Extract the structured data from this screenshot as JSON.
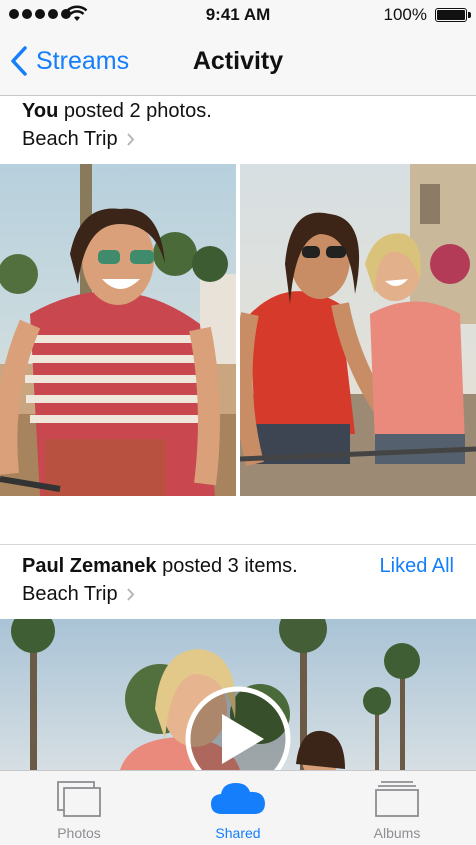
{
  "status_bar": {
    "time": "9:41 AM",
    "battery_percent": "100%"
  },
  "nav": {
    "back_label": "Streams",
    "title": "Activity"
  },
  "posts": [
    {
      "author": "You",
      "action": " posted 2 photos.",
      "album": "Beach Trip"
    },
    {
      "author": "Paul Zemanek",
      "action": " posted 3 items.",
      "album": "Beach Trip",
      "liked_label": "Liked All"
    }
  ],
  "tabs": [
    {
      "label": "Photos",
      "icon": "photos-icon"
    },
    {
      "label": "Shared",
      "icon": "cloud-icon"
    },
    {
      "label": "Albums",
      "icon": "albums-icon"
    }
  ],
  "colors": {
    "accent": "#147efb",
    "inactive": "#8e8e93"
  }
}
